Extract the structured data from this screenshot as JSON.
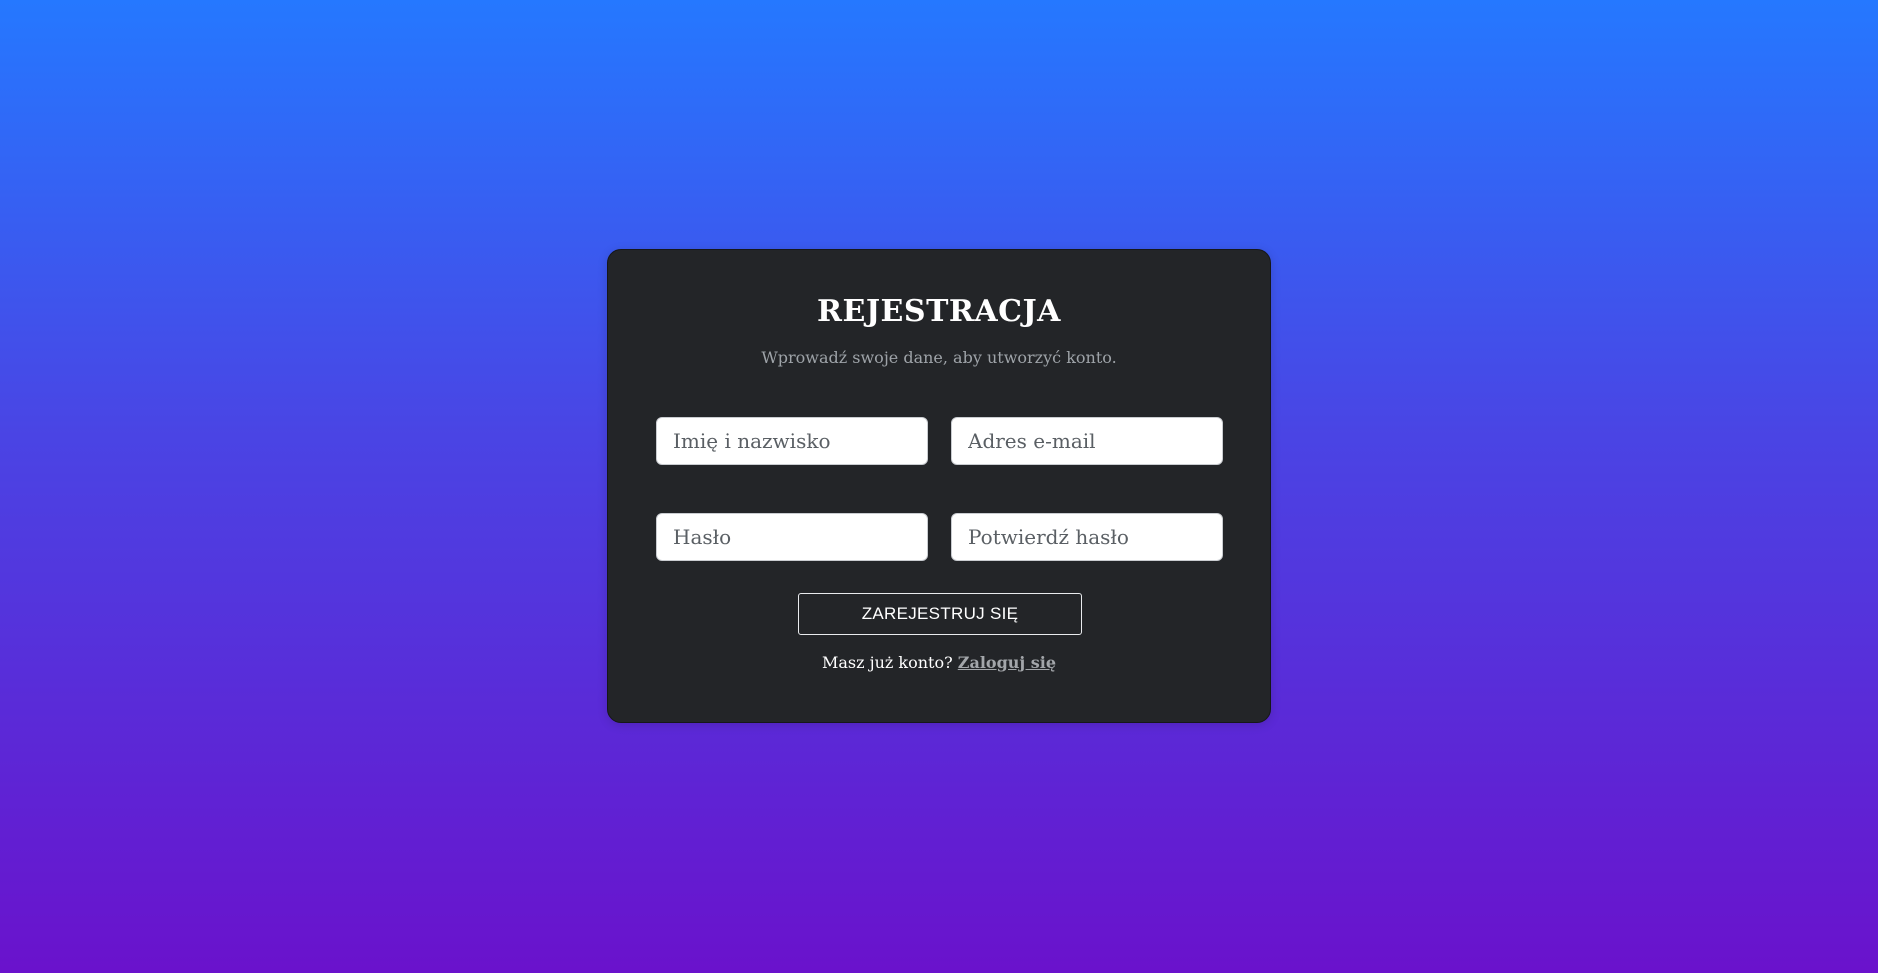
{
  "form": {
    "title": "REJESTRACJA",
    "subtitle": "Wprowadź swoje dane, aby utworzyć konto.",
    "fields": {
      "name_placeholder": "Imię i nazwisko",
      "email_placeholder": "Adres e-mail",
      "password_placeholder": "Hasło",
      "confirm_password_placeholder": "Potwierdź hasło"
    },
    "submit_label": "ZAREJESTRUJ SIĘ",
    "login_prompt": "Masz już konto?",
    "login_link": "Zaloguj się"
  },
  "colors": {
    "bg_gradient_top": "#2578ff",
    "bg_gradient_bottom": "#6a12cc",
    "card_bg": "#232528",
    "title": "#ffffff",
    "subtitle": "#9ea3a8",
    "link": "#a3a6aa"
  }
}
